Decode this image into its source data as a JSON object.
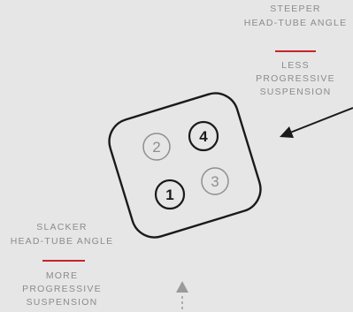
{
  "top_right": {
    "line1": "STEEPER",
    "line2": "HEAD-TUBE ANGLE",
    "sub1": "LESS",
    "sub2": "PROGRESSIVE",
    "sub3": "SUSPENSION"
  },
  "bottom_left": {
    "line1": "SLACKER",
    "line2": "HEAD-TUBE ANGLE",
    "sub1": "MORE",
    "sub2": "PROGRESSIVE",
    "sub3": "SUSPENSION"
  },
  "positions": {
    "p1": "1",
    "p2": "2",
    "p3": "3",
    "p4": "4"
  },
  "colors": {
    "background": "#e6e6e6",
    "outline": "#1a1a1a",
    "muted_text": "#8b8b8b",
    "accent_rule": "#c8242b"
  }
}
